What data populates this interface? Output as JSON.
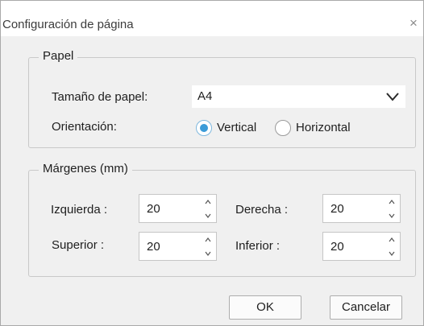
{
  "dialog": {
    "title": "Configuración de página",
    "close_glyph": "×"
  },
  "paper_group": {
    "legend": "Papel",
    "size_label": "Tamaño de papel:",
    "size_value": "A4",
    "orientation_label": "Orientación:",
    "orientation_options": [
      {
        "label": "Vertical",
        "selected": true
      },
      {
        "label": "Horizontal",
        "selected": false
      }
    ]
  },
  "margins_group": {
    "legend": "Márgenes (mm)",
    "left_label": "Izquierda :",
    "left_value": "20",
    "right_label": "Derecha :",
    "right_value": "20",
    "top_label": "Superior :",
    "top_value": "20",
    "bottom_label": "Inferior :",
    "bottom_value": "20"
  },
  "buttons": {
    "ok": "OK",
    "cancel": "Cancelar"
  },
  "colors": {
    "radio_selected": "#3b9bd8",
    "dialog_background": "#f0f0f0"
  },
  "icons": {
    "dropdown": "chevron-down-icon",
    "close": "close-icon",
    "spin_up": "spin-up-icon",
    "spin_down": "spin-down-icon"
  }
}
